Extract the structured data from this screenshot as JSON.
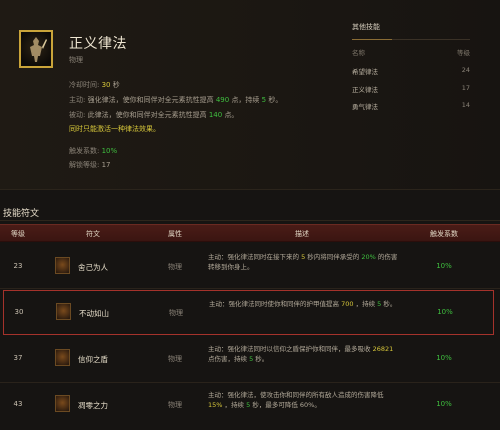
{
  "skill": {
    "name": "正义律法",
    "type": "物理",
    "cooldown_label": "冷却时间:",
    "cooldown_value": "30",
    "cooldown_unit": "秒",
    "active_label": "主动:",
    "active_text_a": "强化律法，使你和同伴对全元素抗性提高",
    "active_value": "490",
    "active_text_b": "点，持续",
    "active_duration": "5",
    "active_text_c": "秒。",
    "passive_label": "被动:",
    "passive_text_a": "此律法，使你和同伴对全元素抗性提高",
    "passive_value": "140",
    "passive_text_b": "点。",
    "note": "同时只能激活一种律法效果。",
    "proc_label": "触发系数:",
    "proc_value": "10%",
    "unlock_label": "解锁等级:",
    "unlock_value": "17"
  },
  "related": {
    "title": "其他技能",
    "col_name": "名称",
    "col_level": "等级",
    "items": [
      {
        "name": "希望律法",
        "level": "24"
      },
      {
        "name": "正义律法",
        "level": "17"
      },
      {
        "name": "勇气律法",
        "level": "14"
      }
    ]
  },
  "runes_section": {
    "title": "技能符文",
    "headers": {
      "level": "等级",
      "rune": "符文",
      "attr": "属性",
      "desc": "描述",
      "proc": "触发系数"
    },
    "rows": [
      {
        "level": "23",
        "rune": "舍己为人",
        "attr": "物理",
        "desc_a": "主动：强化律法同时在接下来的",
        "desc_v1": "5",
        "desc_b": "秒内将同伴承受的",
        "desc_v2": "20%",
        "desc_c": "的伤害转移到你身上。",
        "proc": "10%"
      },
      {
        "level": "30",
        "rune": "不动如山",
        "attr": "物理",
        "desc_a": "主动：强化律法同时使你和同伴的护甲值提高",
        "desc_v1": "700",
        "desc_b": "，持续",
        "desc_v2": "5",
        "desc_c": "秒。",
        "proc": "10%"
      },
      {
        "level": "37",
        "rune": "信仰之盾",
        "attr": "物理",
        "desc_a": "主动：强化律法同时以信仰之盾保护你和同伴，最多吸收",
        "desc_v1": "26821",
        "desc_b": "点伤害，持续",
        "desc_v2": "5",
        "desc_c": "秒。",
        "proc": "10%"
      },
      {
        "level": "43",
        "rune": "凋零之力",
        "attr": "物理",
        "desc_a": "主动：强化律法，使攻击你和同伴的所有敌人造成的伤害降低",
        "desc_v1": "15%",
        "desc_b": "，持续",
        "desc_v2": "5",
        "desc_c": "秒，最多可降低 60%。",
        "proc": "10%"
      }
    ]
  },
  "colors": {
    "value_green": "#3fbf3f",
    "note_yellow": "#d6c63a",
    "header_red": "#4a1c17",
    "highlight_border": "#a5322b"
  }
}
